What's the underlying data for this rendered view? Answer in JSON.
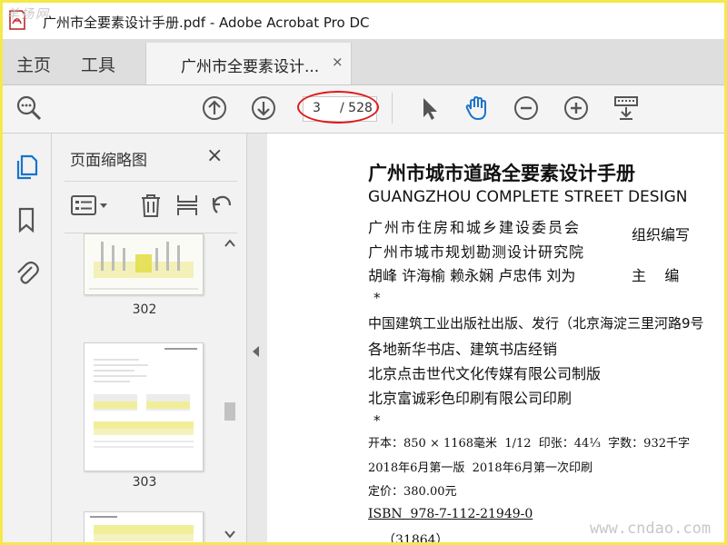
{
  "window": {
    "title": "广州市全要素设计手册.pdf - Adobe Acrobat Pro DC",
    "watermark_top": "羊扬网"
  },
  "tabs": {
    "home": "主页",
    "tools": "工具",
    "document": "广州市全要素设计...",
    "close_glyph": "×"
  },
  "toolbar": {
    "current_page": "3",
    "total_pages": "/ 528",
    "icons": [
      "find-zoom-icon",
      "scroll-up-icon",
      "scroll-down-icon",
      "select-cursor-icon",
      "hand-tool-icon",
      "zoom-out-icon",
      "zoom-in-icon",
      "keyboard-insert-icon"
    ]
  },
  "rail": {
    "icons": [
      "page-thumbnails-icon",
      "bookmark-icon",
      "attachment-icon"
    ]
  },
  "panel": {
    "title": "页面缩略图",
    "close_glyph": "×",
    "thumbnails": [
      {
        "page": "302"
      },
      {
        "page": "303"
      }
    ]
  },
  "document": {
    "title_cn": "广州市城市道路全要素设计手册",
    "title_en": "GUANGZHOU COMPLETE STREET DESIGN",
    "org1": "广州市住房和城乡建设委员会",
    "role1": "组织编写",
    "org2": "广州市城市规划勘测设计研究院",
    "editors": "胡峰 许海榆 赖永娴 卢忠伟 刘为",
    "role2": "主    编",
    "star1": "*",
    "publisher": "中国建筑工业出版社出版、发行（北京海淀三里河路9号",
    "distributor": "各地新华书店、建筑书店经销",
    "production": "北京点击世代文化传媒有限公司制版",
    "printer": "北京富诚彩色印刷有限公司印刷",
    "star2": "*",
    "format": "开本：850 × 1168毫米  1/12  印张：44⅓  字数：932千字",
    "edition": "2018年6月第一版  2018年6月第一次印刷",
    "price": "定价：380.00元",
    "isbn": "ISBN  978-7-112-21949-0",
    "code": "（31864）"
  },
  "watermark_bottom": "www.cndao.com",
  "colors": {
    "frame": "#f5e94a",
    "accent_blue": "#1a73c9",
    "highlight_red": "#e01a1a"
  }
}
